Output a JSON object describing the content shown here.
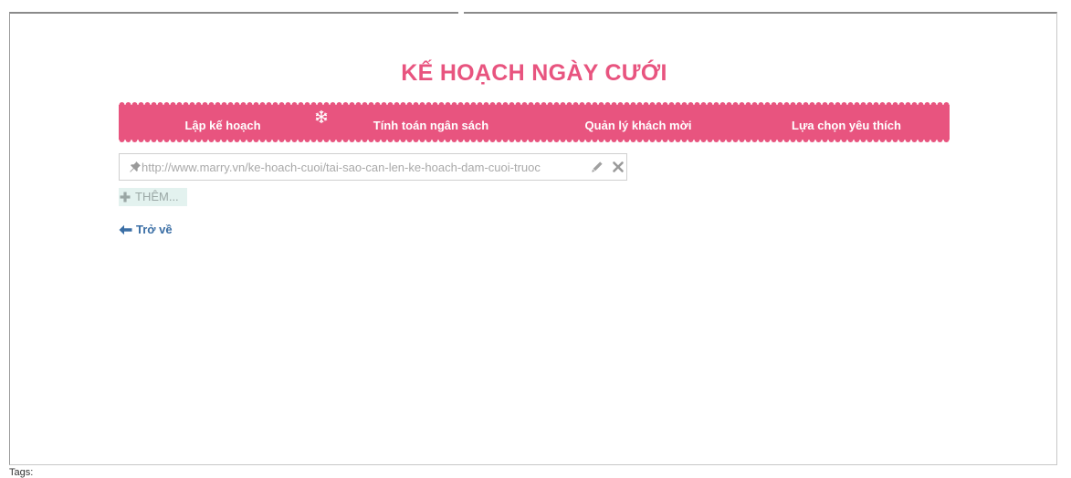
{
  "colors": {
    "brand_pink": "#e8547f",
    "nav_text": "#ffffff",
    "link_blue": "#3a6ea5",
    "add_bg": "#e3f2ef",
    "placeholder_grey": "#a9a9a9"
  },
  "page": {
    "title": "KẾ HOẠCH NGÀY CƯỚI"
  },
  "nav": {
    "items": [
      {
        "label": "Lập kế hoạch"
      },
      {
        "label": "Tính toán ngân sách"
      },
      {
        "label": "Quản lý khách mời"
      },
      {
        "label": "Lựa chọn yêu thích"
      }
    ],
    "decoration_icon": "snowflake-icon"
  },
  "link_field": {
    "value": "http://www.marry.vn/ke-hoach-cuoi/tai-sao-can-len-ke-hoach-dam-cuoi-truoc",
    "icons": [
      "pin-icon",
      "pencil-icon",
      "close-icon"
    ]
  },
  "add_button": {
    "label": "THÊM..."
  },
  "back_link": {
    "label": "Trở về"
  },
  "footer": {
    "tags_label": "Tags:"
  }
}
